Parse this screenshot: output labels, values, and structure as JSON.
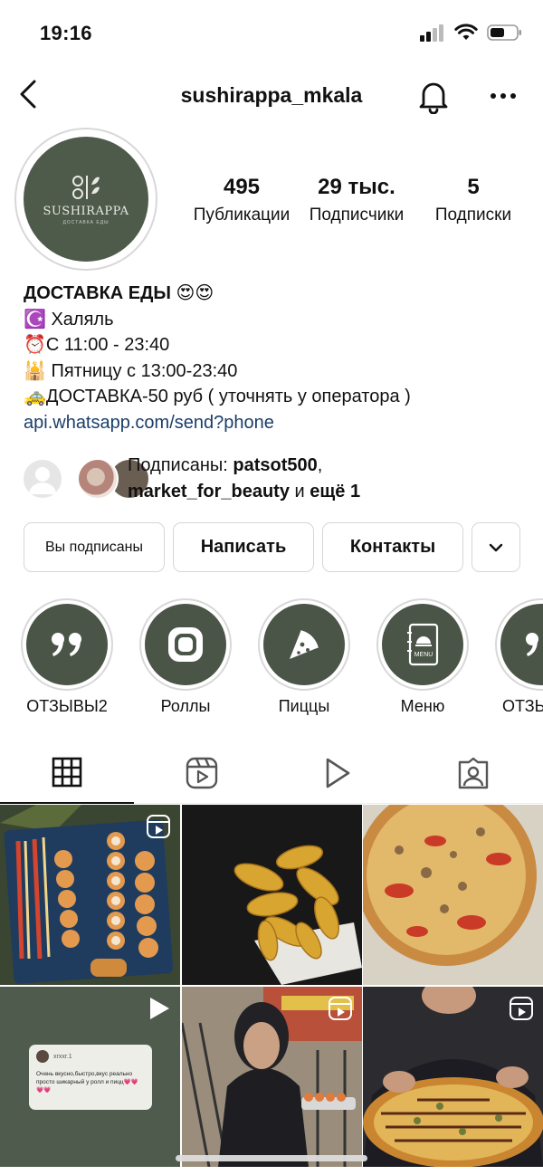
{
  "status": {
    "time": "19:16"
  },
  "header": {
    "username": "sushirappa_mkala"
  },
  "avatar": {
    "brand": "SUSHIRAPPA",
    "sub": "ДОСТАВКА ЕДЫ"
  },
  "stats": [
    {
      "num": "495",
      "label": "Публикации"
    },
    {
      "num": "29 тыс.",
      "label": "Подписчики"
    },
    {
      "num": "5",
      "label": "Подписки"
    }
  ],
  "bio": {
    "title": "ДОСТАВКА ЕДЫ 😍😍",
    "lines": [
      "☪️ Халяль",
      "⏰С 11:00 - 23:40",
      "🕌 Пятницу с 13:00-23:40",
      "🚕ДОСТАВКА-50 руб ( уточнять у оператора )"
    ],
    "link": "api.whatsapp.com/send?phone"
  },
  "followed_by": {
    "prefix": "Подписаны: ",
    "user1": "patsot500",
    "comma": ",",
    "user2": "market_for_beauty",
    "and": " и ",
    "more": "ещё 1"
  },
  "actions": {
    "following": "Вы подписаны",
    "message": "Написать",
    "contacts": "Контакты"
  },
  "highlights": [
    {
      "label": "ОТЗЫВЫ2",
      "icon": "quote-icon"
    },
    {
      "label": "Роллы",
      "icon": "roll-icon"
    },
    {
      "label": "Пиццы",
      "icon": "pizza-slice-icon"
    },
    {
      "label": "Меню",
      "icon": "menu-book-icon"
    },
    {
      "label": "ОТЗЫ",
      "icon": "quote-icon"
    }
  ],
  "posts": {
    "review": {
      "user": "xrxxr.1",
      "text": "Очень вкусно,быстро,вкус реально просто шикарный у ролл и пицц💗💗💗💗"
    }
  },
  "colors": {
    "highlight_bg": "#4a5547",
    "avatar_bg": "#4e5a4a",
    "link": "#1b3e6b"
  }
}
